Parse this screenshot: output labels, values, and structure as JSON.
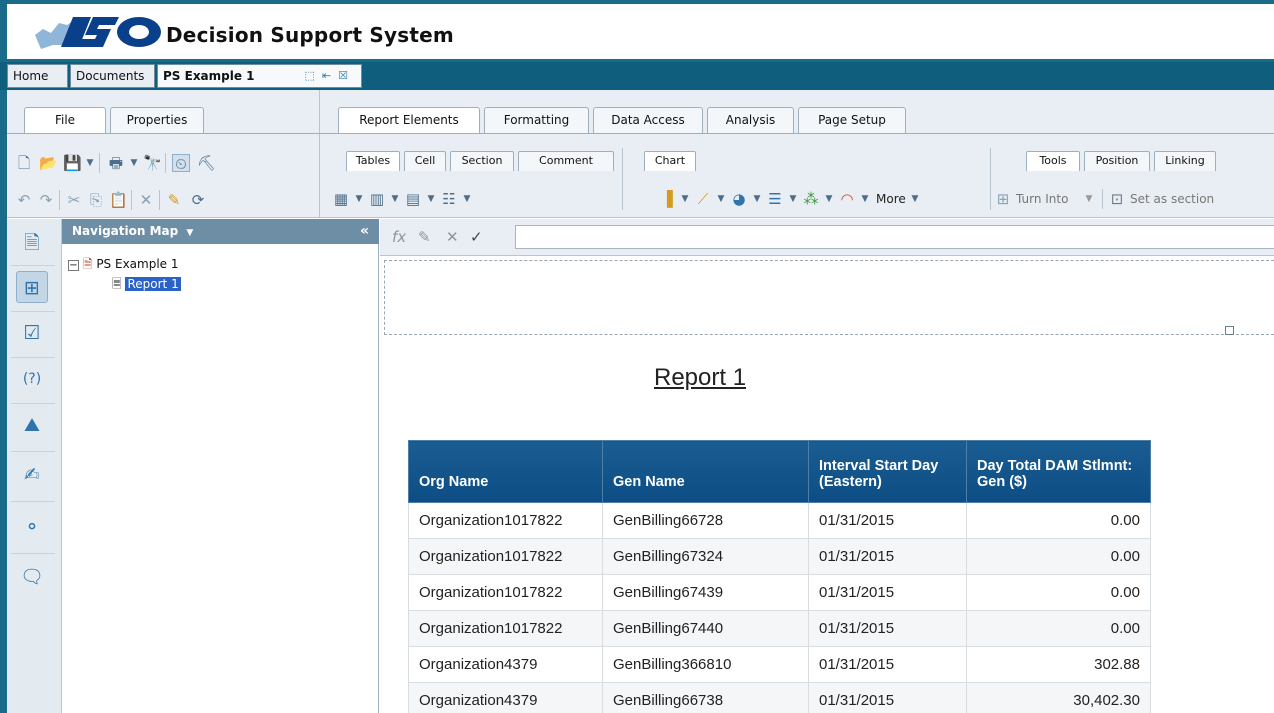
{
  "header": {
    "title": "Decision Support System",
    "logo_text": "ISO"
  },
  "document_tabs": [
    {
      "label": "Home"
    },
    {
      "label": "Documents"
    },
    {
      "label": "PS Example 1"
    }
  ],
  "left_ribbon": {
    "tabs": [
      "File",
      "Properties"
    ]
  },
  "right_ribbon": {
    "tabs": [
      "Report Elements",
      "Formatting",
      "Data Access",
      "Analysis",
      "Page Setup"
    ],
    "subtabs_left": [
      "Tables",
      "Cell",
      "Section",
      "Comment"
    ],
    "subtab_chart": "Chart",
    "subtabs_right": [
      "Tools",
      "Position",
      "Linking"
    ],
    "more_label": "More",
    "turn_into_label": "Turn Into",
    "set_as_section_label": "Set as section"
  },
  "nav_panel": {
    "title": "Navigation Map",
    "tree": [
      {
        "label": "PS Example 1"
      },
      {
        "label": "Report 1"
      }
    ]
  },
  "report": {
    "title": "Report 1",
    "columns": [
      "Org Name",
      "Gen Name",
      "Interval Start Day (Eastern)",
      "Day Total DAM Stlmnt: Gen ($)"
    ],
    "rows": [
      [
        "Organization1017822",
        "GenBilling66728",
        "01/31/2015",
        "0.00"
      ],
      [
        "Organization1017822",
        "GenBilling67324",
        "01/31/2015",
        "0.00"
      ],
      [
        "Organization1017822",
        "GenBilling67439",
        "01/31/2015",
        "0.00"
      ],
      [
        "Organization1017822",
        "GenBilling67440",
        "01/31/2015",
        "0.00"
      ],
      [
        "Organization4379",
        "GenBilling366810",
        "01/31/2015",
        "302.88"
      ],
      [
        "Organization4379",
        "GenBilling66738",
        "01/31/2015",
        "30,402.30"
      ]
    ]
  },
  "colors": {
    "header_band": "#1a6a8a",
    "table_header": "#0d4d85",
    "accent": "#2a62c8"
  }
}
